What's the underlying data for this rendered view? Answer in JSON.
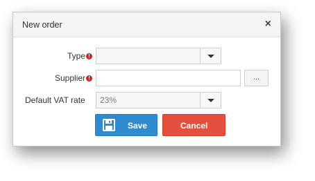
{
  "dialog": {
    "title": "New order",
    "close_glyph": "×"
  },
  "fields": {
    "type": {
      "label": "Type",
      "required_glyph": "!",
      "value": ""
    },
    "supplier": {
      "label": "Supplier",
      "required_glyph": "!",
      "value": "",
      "browse_label": "..."
    },
    "vat": {
      "label": "Default VAT rate",
      "value": "23%"
    }
  },
  "buttons": {
    "save_label": "Save",
    "cancel_label": "Cancel"
  },
  "colors": {
    "save": "#2f8ad0",
    "cancel": "#e3503e",
    "required": "#cc2222"
  },
  "icons": {
    "save": "floppy-disk-icon",
    "close": "close-icon",
    "dropdown": "chevron-down-icon",
    "required": "exclamation-circle-icon"
  }
}
